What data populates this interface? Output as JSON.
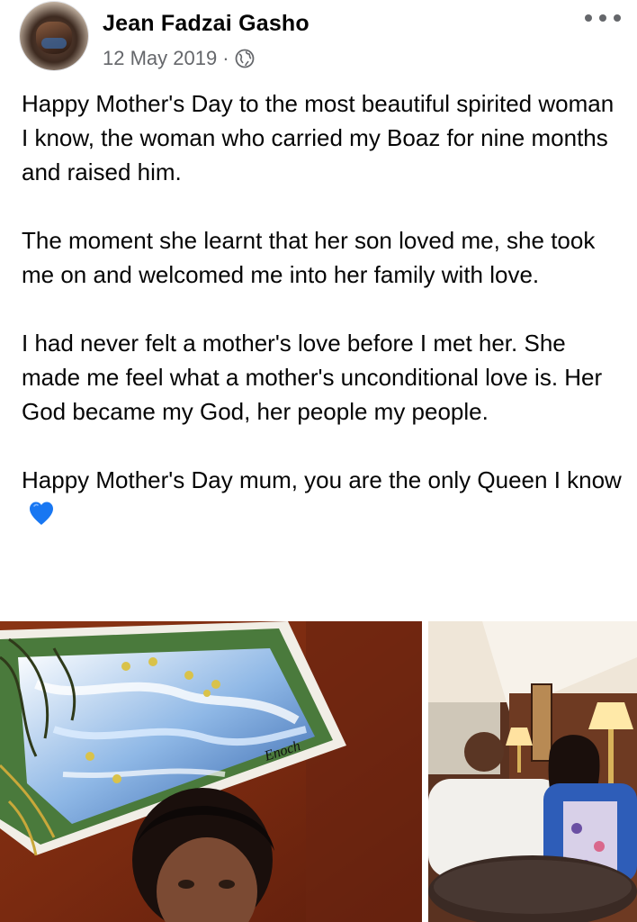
{
  "post": {
    "author_name": "Jean Fadzai Gasho",
    "date": "12 May 2019",
    "separator": "·",
    "audience_icon": "globe-icon",
    "more_icon": "more-options-icon",
    "paragraphs": [
      "Happy Mother's Day to the most beautiful spirited woman I know,  the woman who carried my Boaz for nine months and raised him.",
      "The moment she learnt that her son loved me, she took me on and welcomed me into her family with love.",
      "I had never felt a mother's love before I met her. She made me feel what a mother's unconditional love is.  Her God became my God, her people my people.",
      "Happy Mother's Day mum,  you are the only Queen I know"
    ],
    "emoji": "blue-heart-icon",
    "photos": [
      {
        "name": "photo-woman-with-painting",
        "signature": "Enoch"
      },
      {
        "name": "photo-couple-at-table"
      }
    ]
  },
  "colors": {
    "text": "#050505",
    "meta": "#65676b",
    "heart": "#1877f2"
  }
}
